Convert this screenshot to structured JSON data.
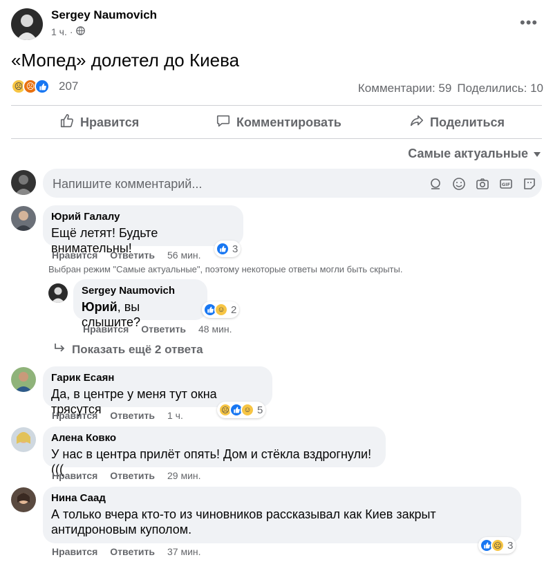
{
  "post": {
    "author": "Sergey Naumovich",
    "time": "1 ч.",
    "privacy_icon": "globe-icon",
    "text": "«Мопед» долетел до Киева",
    "reactions": {
      "icons": [
        "sad-emoji-icon",
        "angry-emoji-icon",
        "like-icon"
      ],
      "count": "207"
    },
    "comments_stat": "Комментарии: 59",
    "shares_stat": "Поделились: 10"
  },
  "actions": {
    "like": "Нравится",
    "comment": "Комментировать",
    "share": "Поделиться"
  },
  "sort": {
    "label": "Самые актуальные"
  },
  "composer": {
    "placeholder": "Напишите комментарий..."
  },
  "comments": [
    {
      "author": "Юрий Галалу",
      "text": "Ещё летят! Будьте внимательны!",
      "like": "Нравится",
      "reply": "Ответить",
      "time": "56 мин.",
      "reaction_count": "3"
    },
    {
      "author": "Sergey Naumovich",
      "mention": "Юрий",
      "text": ", вы слышите?",
      "like": "Нравится",
      "reply": "Ответить",
      "time": "48 мин.",
      "reaction_count": "2"
    },
    {
      "author": "Гарик Есаян",
      "text": "Да, в центре у меня тут окна трясутся",
      "like": "Нравится",
      "reply": "Ответить",
      "time": "1 ч.",
      "reaction_count": "5"
    },
    {
      "author": "Алена Ковко",
      "text": "У нас в центра прилёт опять! Дом и стёкла вздрогнули!(((",
      "like": "Нравится",
      "reply": "Ответить",
      "time": "29 мин."
    },
    {
      "author": "Нина Саад",
      "text_line1": "А только вчера кто-то из чиновников рассказывал как Киев закрыт",
      "text_line2": "антидроновым куполом.",
      "like": "Нравится",
      "reply": "Ответить",
      "time": "37 мин.",
      "reaction_count": "3"
    }
  ],
  "hidden_note": "Выбран режим \"Самые актуальные\", поэтому некоторые ответы могли быть скрыты.",
  "show_more": "Показать ещё 2 ответа",
  "colors": {
    "bubble": "#f0f2f5",
    "secondary_text": "#65676b",
    "like_blue": "#1877f2"
  }
}
